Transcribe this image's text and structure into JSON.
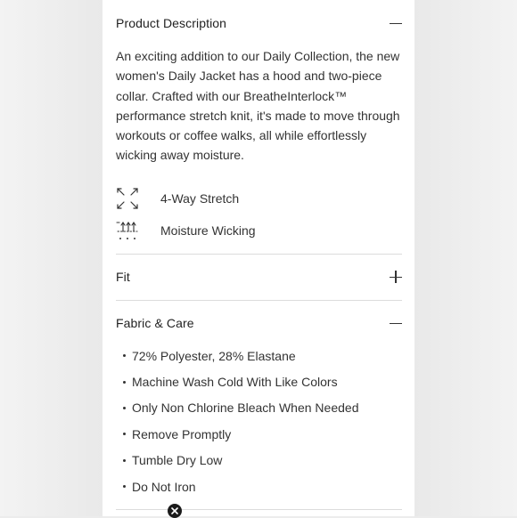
{
  "product_description": {
    "title": "Product Description",
    "text": "An exciting addition to our Daily Collection, the new women's Daily Jacket has a hood and two-piece collar. Crafted with our BreatheInterlock™ performance stretch knit, it's made to move through workouts or coffee walks, all while effortlessly wicking away moisture.",
    "toggle_icon": "minus-icon",
    "features": [
      {
        "icon": "four-way-stretch-icon",
        "label": "4-Way Stretch"
      },
      {
        "icon": "moisture-wicking-icon",
        "label": "Moisture Wicking"
      }
    ]
  },
  "fit": {
    "title": "Fit",
    "toggle_icon": "plus-icon"
  },
  "fabric_care": {
    "title": "Fabric & Care",
    "toggle_icon": "minus-icon",
    "items": [
      "72% Polyester, 28% Elastane",
      "Machine Wash Cold With Like Colors",
      "Only Non Chlorine Bleach When Needed",
      "Remove Promptly",
      "Tumble Dry Low",
      "Do Not Iron"
    ]
  },
  "close_icon": "close-icon"
}
